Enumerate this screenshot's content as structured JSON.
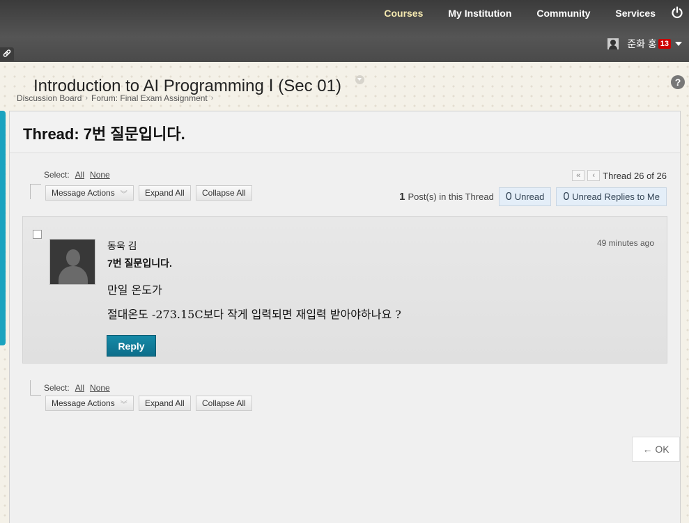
{
  "nav": {
    "items": [
      "Courses",
      "My Institution",
      "Community",
      "Services"
    ],
    "user_name": "준화 홍",
    "notification_count": "13"
  },
  "course": {
    "title": "Introduction to AI Programming Ⅰ (Sec 01)"
  },
  "breadcrumb": [
    "Discussion Board",
    "Forum: Final Exam Assignment"
  ],
  "thread": {
    "title": "Thread: 7번 질문입니다.",
    "pager": "Thread 26 of 26",
    "post_count": "1",
    "post_count_label": "Post(s) in this Thread",
    "unread_count": "0",
    "unread_label": "Unread",
    "unread_replies_count": "0",
    "unread_replies_label": "Unread Replies to Me"
  },
  "toolbar": {
    "select_label": "Select:",
    "all_label": "All",
    "none_label": "None",
    "message_actions_label": "Message Actions",
    "expand_all_label": "Expand All",
    "collapse_all_label": "Collapse All"
  },
  "post": {
    "author": "동욱 김",
    "time": "49 minutes ago",
    "subject": "7번 질문입니다.",
    "body_line1": "만일 온도가",
    "body_line2": "절대온도 -273.15C보다 작게 입력되면 재입력 받아야하나요 ?",
    "reply_label": "Reply"
  },
  "footer": {
    "ok_label": "← OK"
  }
}
